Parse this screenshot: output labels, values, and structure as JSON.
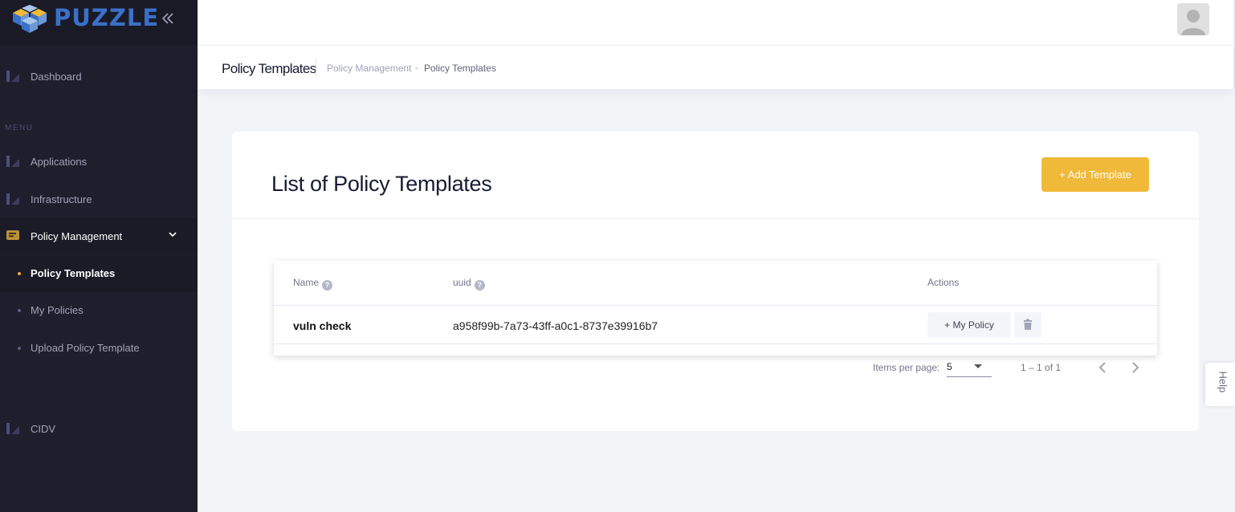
{
  "brand": {
    "name": "PUZZLE"
  },
  "sidebar": {
    "menu_section": "MENU",
    "items": [
      {
        "label": "Dashboard",
        "icon": "chart-icon"
      },
      {
        "label": "Applications",
        "icon": "chart-icon"
      },
      {
        "label": "Infrastructure",
        "icon": "chart-icon"
      },
      {
        "label": "Policy Management",
        "icon": "message-icon",
        "expanded": true
      },
      {
        "label": "CIDV",
        "icon": "chart-icon"
      }
    ],
    "sub_items": [
      {
        "label": "Policy Templates",
        "active": true
      },
      {
        "label": "My Policies"
      },
      {
        "label": "Upload Policy Template"
      }
    ]
  },
  "subheader": {
    "title": "Policy Templates",
    "breadcrumb": [
      "Policy Management",
      "Policy Templates"
    ],
    "breadcrumb_separator": "-"
  },
  "card": {
    "title": "List of Policy Templates",
    "add_button": "+ Add Template"
  },
  "table": {
    "columns": [
      "Name",
      "uuid",
      "Actions"
    ],
    "rows": [
      {
        "name": "vuln check",
        "uuid": "a958f99b-7a73-43ff-a0c1-8737e39916b7",
        "action_label": "+ My Policy"
      }
    ]
  },
  "paginator": {
    "items_per_page_label": "Items per page:",
    "items_per_page": "5",
    "range": "1 – 1 of 1"
  },
  "help_tab": "Help",
  "colors": {
    "sidebar_bg": "#1e1e2d",
    "accent": "#f0b93a",
    "brand_blue": "#3a70c8"
  }
}
